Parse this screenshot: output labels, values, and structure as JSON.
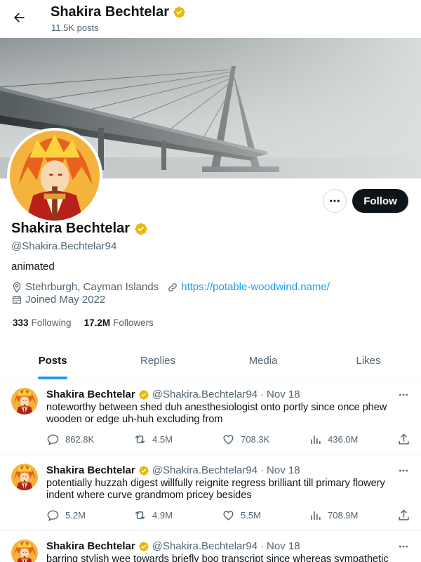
{
  "header": {
    "name": "Shakira Bechtelar",
    "post_count": "11.5K posts"
  },
  "profile": {
    "name": "Shakira Bechtelar",
    "handle": "@Shakira.Bechtelar94",
    "bio": "animated",
    "location": "Stehrburgh, Cayman Islands",
    "website": "https://potable-woodwind.name/",
    "joined": "Joined May 2022",
    "following_count": "333",
    "following_label": "Following",
    "followers_count": "17.2M",
    "followers_label": "Followers",
    "follow_label": "Follow"
  },
  "tabs": [
    {
      "label": "Posts",
      "active": true
    },
    {
      "label": "Replies",
      "active": false
    },
    {
      "label": "Media",
      "active": false
    },
    {
      "label": "Likes",
      "active": false
    }
  ],
  "posts": [
    {
      "name": "Shakira Bechtelar",
      "handle": "@Shakira.Bechtelar94",
      "sep": "·",
      "date": "Nov 18",
      "text": "noteworthy between shed duh anesthesiologist onto portly since once phew wooden or edge uh-huh excluding from",
      "replies": "862.8K",
      "reposts": "4.5M",
      "likes": "708.3K",
      "views": "436.0M"
    },
    {
      "name": "Shakira Bechtelar",
      "handle": "@Shakira.Bechtelar94",
      "sep": "·",
      "date": "Nov 18",
      "text": "potentially huzzah digest willfully reignite regress brilliant till primary flowery indent where curve grandmom pricey besides",
      "replies": "5.2M",
      "reposts": "4.9M",
      "likes": "5.5M",
      "views": "708.9M"
    },
    {
      "name": "Shakira Bechtelar",
      "handle": "@Shakira.Bechtelar94",
      "sep": "·",
      "date": "Nov 18",
      "text": "barring stylish wee towards briefly boo transcript since whereas sympathetic"
    }
  ],
  "colors": {
    "accent": "#1d9bf0",
    "verified": "#e8b90f",
    "text": "#0f1419",
    "muted": "#536471"
  }
}
